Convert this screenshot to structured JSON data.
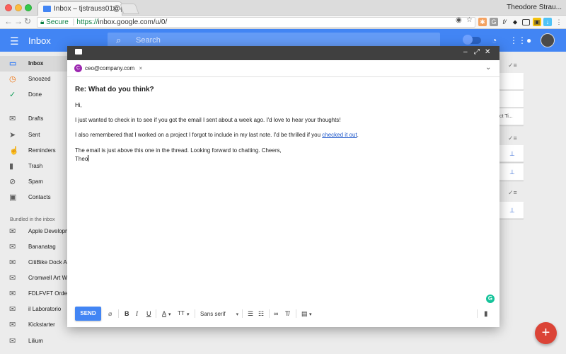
{
  "browser": {
    "tab_title": "Inbox – tjstrauss01@gmail.com",
    "tab_close": "✕",
    "user_name": "Theodore Strau...",
    "secure_label": "Secure",
    "url_scheme": "https://",
    "url_rest": "inbox.google.com/u/0/",
    "back_glyph": "←",
    "forward_glyph": "→",
    "reload_glyph": "↻"
  },
  "app": {
    "title": "Inbox",
    "search_placeholder": "Search",
    "menu_glyph": "☰",
    "search_glyph": "⌕"
  },
  "sidebar": {
    "items": [
      {
        "label": "Inbox",
        "icon": "inbox-icon",
        "glyph": "▭"
      },
      {
        "label": "Snoozed",
        "icon": "clock-icon",
        "glyph": "◷"
      },
      {
        "label": "Done",
        "icon": "check-icon",
        "glyph": "✓"
      },
      {
        "label": "Drafts",
        "icon": "drafts-icon",
        "glyph": "✉"
      },
      {
        "label": "Sent",
        "icon": "send-icon",
        "glyph": "➤"
      },
      {
        "label": "Reminders",
        "icon": "finger-icon",
        "glyph": "☝"
      },
      {
        "label": "Trash",
        "icon": "trash-icon",
        "glyph": "▮"
      },
      {
        "label": "Spam",
        "icon": "spam-icon",
        "glyph": "⊘"
      },
      {
        "label": "Contacts",
        "icon": "contacts-icon",
        "glyph": "▣"
      }
    ],
    "bundled_heading": "Bundled in the inbox",
    "bundles": [
      {
        "label": "Apple Developm",
        "icon": "envelope-icon",
        "glyph": "✉"
      },
      {
        "label": "Bananatag",
        "icon": "envelope-icon",
        "glyph": "✉"
      },
      {
        "label": "CitiBike Dock Al",
        "icon": "envelope-icon",
        "glyph": "✉"
      },
      {
        "label": "Cromwell Art We",
        "icon": "envelope-icon",
        "glyph": "✉"
      },
      {
        "label": "FDLFVFT Orders",
        "icon": "envelope-icon",
        "glyph": "✉"
      },
      {
        "label": "il Laboratorio",
        "icon": "envelope-icon",
        "glyph": "✉"
      },
      {
        "label": "Kickstarter",
        "icon": "envelope-icon",
        "glyph": "✉"
      },
      {
        "label": "Lilium",
        "icon": "envelope-icon",
        "glyph": "✉"
      }
    ]
  },
  "background_list": {
    "snippet": "ct Ti...",
    "fab_glyph": "+"
  },
  "compose": {
    "minimize_glyph": "–",
    "fullscreen_glyph": "⤢",
    "close_glyph": "✕",
    "recipient": "ceo@company.com",
    "recipient_initial": "C",
    "recipient_remove": "×",
    "expand_glyph": "⌄",
    "subject": "Re: What do you think?",
    "body": {
      "greeting": "Hi,",
      "p1": "I just wanted to check in to see if you got the email I sent about a week ago. I'd love to hear your thoughts!",
      "p2_before": "I also remembered that I worked on a project I forgot to include in my last note. I'd be thrilled if you ",
      "p2_link": "checked it out",
      "p2_after": ".",
      "p3": "The email is just above this one in the thread. Looking forward to chatting. Cheers,",
      "signature": "Theo"
    },
    "grammarly": "G",
    "send_label": "SEND",
    "font_name": "Sans serif",
    "tools": {
      "attach": "⌀",
      "bold": "B",
      "italic": "I",
      "underline": "U",
      "text_color": "A",
      "text_size": "TT",
      "bulleted": "☰",
      "numbered": "☷",
      "link": "∞",
      "clear": "T̸",
      "template": "▤",
      "dropdown": "▾",
      "trash": "▮"
    }
  }
}
